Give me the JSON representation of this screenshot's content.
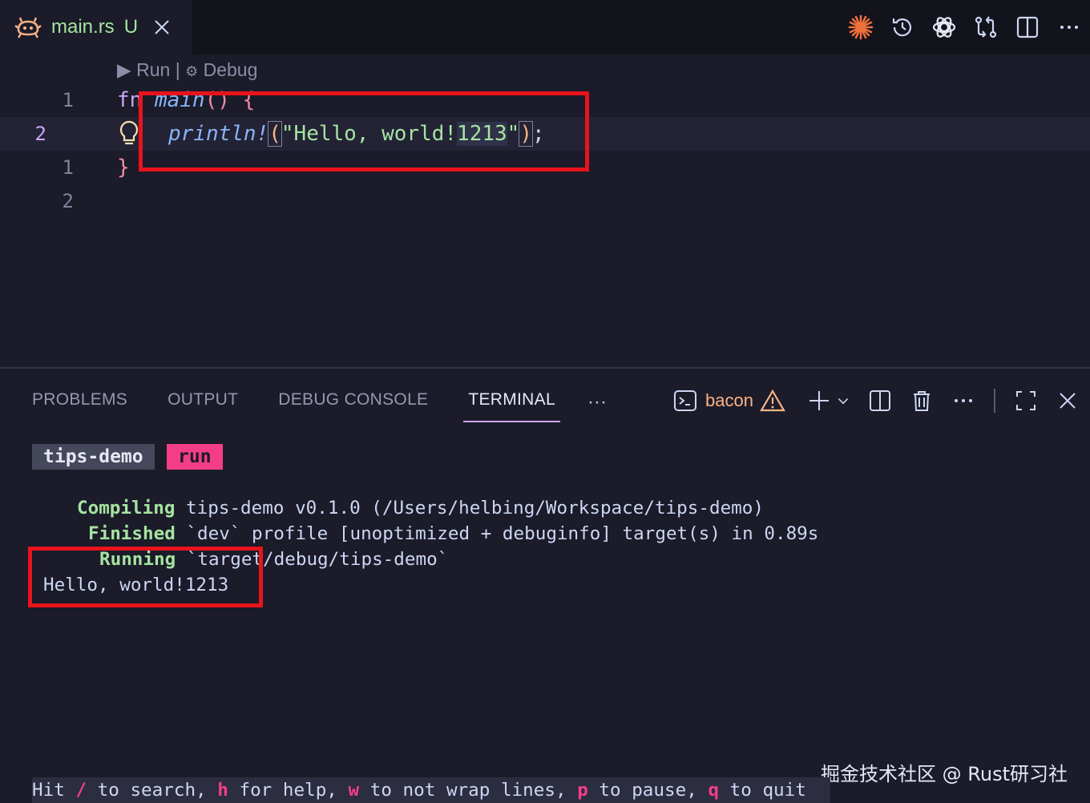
{
  "tab": {
    "filename": "main.rs",
    "status": "U"
  },
  "editor": {
    "codelens": {
      "run": "Run",
      "sep": "|",
      "debug": "Debug"
    },
    "lines": [
      {
        "num": "1",
        "tokens": [
          "fn",
          "main",
          "()",
          " ",
          "{"
        ]
      },
      {
        "num": "2",
        "macro": "println!",
        "open": "(",
        "str_a": "\"Hello, world!",
        "str_b": "1213",
        "str_c": "\"",
        "close": ")",
        "semi": ";"
      },
      {
        "num": "1",
        "brace": "}"
      },
      {
        "num": "2"
      }
    ]
  },
  "panel": {
    "tabs": [
      "PROBLEMS",
      "OUTPUT",
      "DEBUG CONSOLE",
      "TERMINAL"
    ],
    "more": "···",
    "terminal_name": "bacon"
  },
  "terminal": {
    "project": "tips-demo",
    "mode": "run",
    "lines": [
      {
        "label": "Compiling",
        "text": " tips-demo v0.1.0 (/Users/helbing/Workspace/tips-demo)"
      },
      {
        "label": "Finished",
        "text": " `dev` profile [unoptimized + debuginfo] target(s) in 0.89s"
      },
      {
        "label": "Running",
        "text": " `target/debug/tips-demo`"
      }
    ],
    "output": "Hello, world!1213"
  },
  "statusbar": {
    "p1": "Hit ",
    "k1": "/",
    "p2": " to search, ",
    "k2": "h",
    "p3": " for help, ",
    "k3": "w",
    "p4": " to not wrap lines, ",
    "k4": "p",
    "p5": " to pause, ",
    "k5": "q",
    "p6": " to quit"
  },
  "watermark": "掘金技术社区 @ Rust研习社",
  "colors": {
    "accent": "#cba6f7",
    "highlight_box": "#e8131c",
    "key": "#f33e86",
    "ok": "#a6e3a1"
  }
}
